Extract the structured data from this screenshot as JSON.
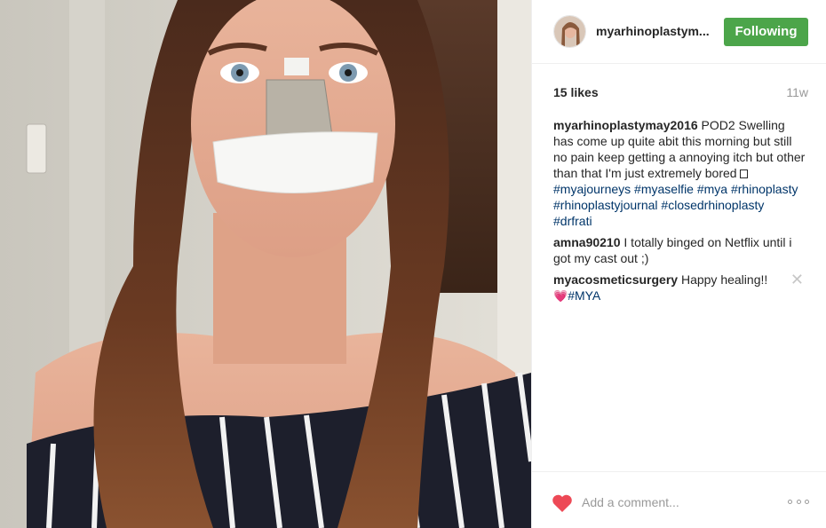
{
  "post": {
    "photo": {
      "alt_icon": "selfie-photo"
    }
  },
  "header": {
    "username": "myarhinoplastym...",
    "follow_label": "Following",
    "follow_color": "#4ca54a"
  },
  "stats": {
    "likes": "15 likes",
    "time_ago": "11w"
  },
  "caption": {
    "author": "myarhinoplastymay2016",
    "text": " POD2 Swelling has come up quite abit this morning but still no pain keep getting a annoying itch but other than that I'm just extremely bored ",
    "tags": [
      "#myajourneys",
      "#myaselfie",
      "#mya",
      "#rhinoplasty",
      "#rhinoplastyjournal",
      "#closedrhinoplasty",
      "#drfrati"
    ]
  },
  "comments": [
    {
      "author": "amna90210",
      "text": " I totally binged on Netflix until i got my cast out ;)"
    },
    {
      "author": "myacosmeticsurgery",
      "text": " Happy healing!!",
      "tag": "#MYA",
      "emoji": "💗"
    }
  ],
  "footer": {
    "comment_placeholder": "Add a comment...",
    "heart_color": "#ed4956"
  },
  "icons": {
    "like": "heart-icon",
    "more": "more-options-icon",
    "delete": "close-icon"
  }
}
